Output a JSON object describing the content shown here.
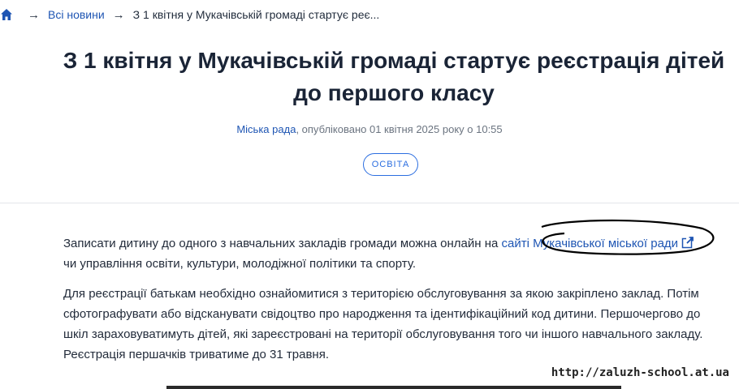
{
  "breadcrumb": {
    "home_icon": "home-icon",
    "separator": "→",
    "all_news": "Всі новини",
    "current": "З 1 квітня у Мукачівській громаді стартує реє..."
  },
  "article": {
    "title": "З 1 квітня у Мукачівській громаді стартує реєстрація дітей до першого класу",
    "author": "Міська рада",
    "published": ", опубліковано 01 квітня 2025 року о 10:55",
    "tag": "ОСВІТА",
    "paragraph1_before": "Записати дитину до одного з навчальних закладів громади можна онлайн на ",
    "paragraph1_link": "сайті Мукачівської міської ради",
    "paragraph1_after": " чи управління освіти, культури, молодіжної політики та спорту.",
    "paragraph2": "Для реєстрації батькам необхідно ознайомитися з територією обслуговування за якою закріплено заклад. Потім сфотографувати або відсканувати свідоцтво про народження та ідентифікаційний код дитини. Першочергово до шкіл зараховуватимуть дітей, які зареєстровані на території обслуговування того чи іншого навчального закладу. Реєстрація першачків триватиме до 31 травня."
  },
  "watermark": "http://zaluzh-school.at.ua",
  "colors": {
    "link": "#1e55b3",
    "tag_border": "#2b6ee0"
  }
}
